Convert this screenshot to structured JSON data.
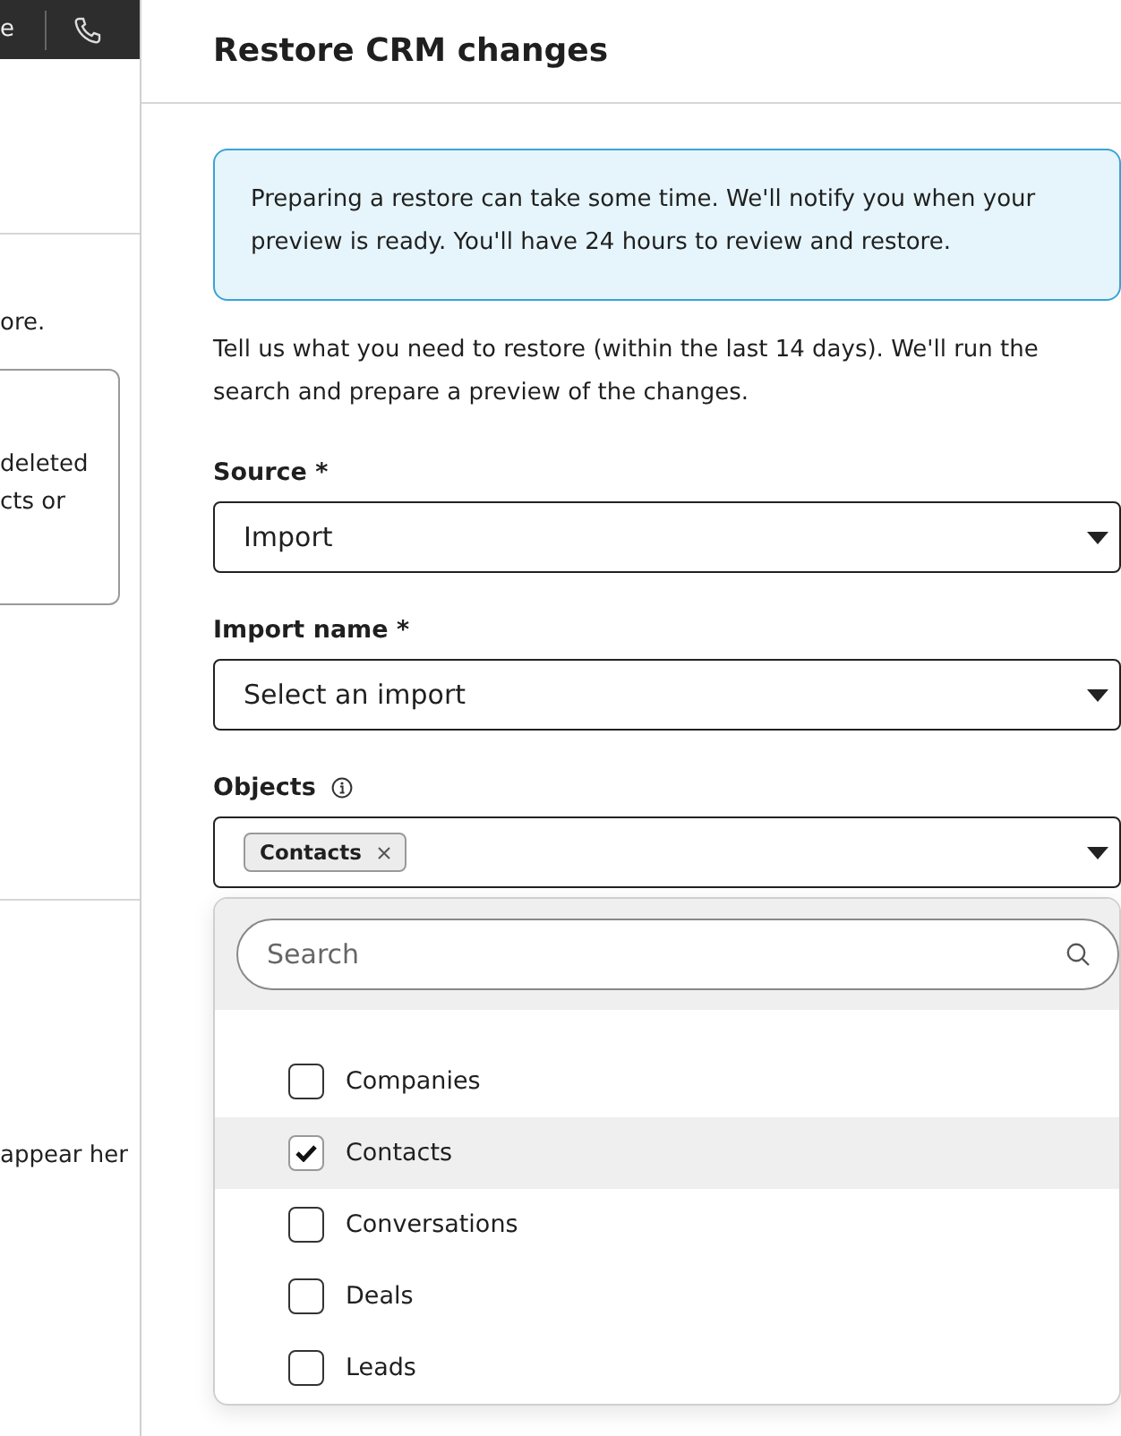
{
  "background_page": {
    "top_bar_text": "e",
    "text_1": "ore.",
    "card_lines": [
      "deleted",
      "cts or"
    ],
    "text_2": "appear her"
  },
  "panel": {
    "title": "Restore CRM changes",
    "notice": "Preparing a restore can take some time. We'll notify you when your preview is ready. You'll have 24 hours to review and restore.",
    "intro": "Tell us what you need to restore (within the last 14 days). We'll run the search and prepare a preview of the changes.",
    "fields": [
      {
        "kind": "select",
        "label": "Source *",
        "value": "Import"
      },
      {
        "kind": "select",
        "label": "Import name *",
        "placeholder": "Select an import"
      },
      {
        "kind": "multiselect",
        "label": "Objects",
        "info": true,
        "tags": [
          "Contacts"
        ]
      }
    ],
    "dropdown": {
      "search_placeholder": "Search",
      "options": [
        {
          "label": "Companies",
          "checked": false,
          "highlighted": false
        },
        {
          "label": "Contacts",
          "checked": true,
          "highlighted": true
        },
        {
          "label": "Conversations",
          "checked": false,
          "highlighted": false
        },
        {
          "label": "Deals",
          "checked": false,
          "highlighted": false
        },
        {
          "label": "Leads",
          "checked": false,
          "highlighted": false
        }
      ]
    }
  }
}
